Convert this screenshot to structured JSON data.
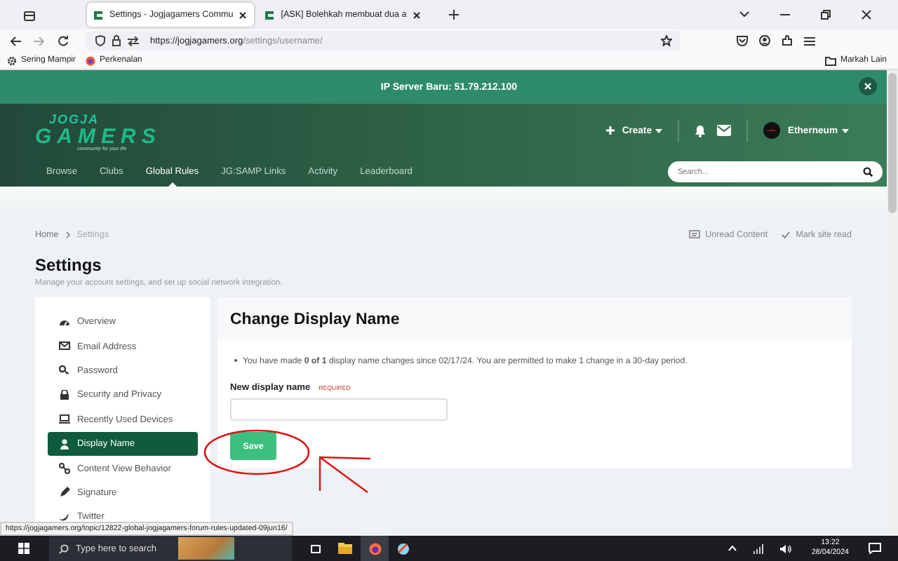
{
  "browser": {
    "tabs": [
      {
        "title": "Settings - Jogjagamers Commu",
        "selected": true
      },
      {
        "title": "[ASK] Bolehkah membuat dua a",
        "selected": false
      }
    ],
    "url_domain": "https://jogjagamers.org",
    "url_path": "/settings/username/",
    "bookmarks": [
      "Sering Mampir",
      "Perkenalan"
    ],
    "other_bookmarks": "Markah Lain"
  },
  "banner": {
    "text": "IP Server Baru: 51.79.212.100"
  },
  "header": {
    "logo_top": "JOGJA",
    "logo_bottom": "GAMERS",
    "tagline": "community for your life",
    "create": "Create",
    "user": "Etherneum",
    "nav": [
      {
        "label": "Browse",
        "selected": false
      },
      {
        "label": "Clubs",
        "selected": false
      },
      {
        "label": "Global Rules",
        "selected": true
      },
      {
        "label": "JG:SAMP Links",
        "selected": false
      },
      {
        "label": "Activity",
        "selected": false
      },
      {
        "label": "Leaderboard",
        "selected": false
      }
    ],
    "search": {
      "placeholder": "Search..."
    }
  },
  "breadcrumb": [
    "Home",
    "Settings"
  ],
  "page_actions": [
    "Unread Content",
    "Mark site read"
  ],
  "page": {
    "title": "Settings",
    "subtitle": "Manage your account settings, and set up social network integration."
  },
  "sidebar": {
    "items": [
      {
        "label": "Overview",
        "selected": false
      },
      {
        "label": "Email Address",
        "selected": false
      },
      {
        "label": "Password",
        "selected": false
      },
      {
        "label": "Security and Privacy",
        "selected": false
      },
      {
        "label": "Recently Used Devices",
        "selected": false
      },
      {
        "label": "Display Name",
        "selected": true
      },
      {
        "label": "Content View Behavior",
        "selected": false
      },
      {
        "label": "Signature",
        "selected": false
      },
      {
        "label": "Twitter",
        "selected": false
      }
    ]
  },
  "form": {
    "title": "Change Display Name",
    "notice": "You have made **0 of 1** display name changes since 02/17/24. You are permitted to make 1 change in a 30-day period.",
    "field_label": "New display name",
    "required": "REQUIRED",
    "save": "Save"
  },
  "status_url": "https://jogjagamers.org/topic/12822-global-jogjagamers-forum-rules-updated-09jun16/",
  "taskbar": {
    "search_placeholder": "Type here to search",
    "time": "13:22",
    "date": "28/04/2024"
  }
}
